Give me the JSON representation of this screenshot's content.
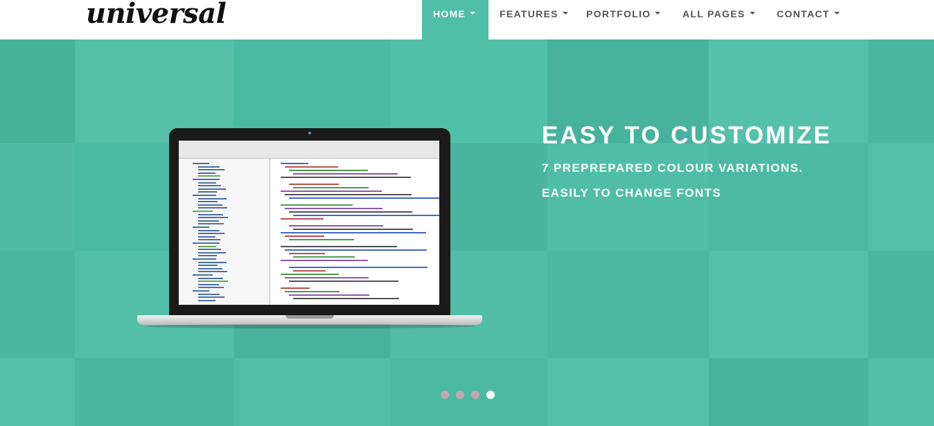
{
  "header": {
    "logo_text": "universal",
    "nav": [
      {
        "label": "HOME",
        "active": true
      },
      {
        "label": "FEATURES",
        "active": false
      },
      {
        "label": "PORTFOLIO",
        "active": false
      },
      {
        "label": "ALL PAGES",
        "active": false
      },
      {
        "label": "CONTACT",
        "active": false
      }
    ]
  },
  "hero": {
    "headline": "EASY TO CUSTOMIZE",
    "line1": "7 PREPREPARED COLOUR VARIATIONS.",
    "line2": "EASILY TO CHANGE FONTS",
    "slides": [
      {
        "active": false
      },
      {
        "active": false
      },
      {
        "active": false
      },
      {
        "active": true
      }
    ]
  },
  "colors": {
    "accent": "#4fbfa8",
    "header_bg": "#ffffff",
    "nav_text": "#555555",
    "dot_inactive": "#c4a6b2",
    "dot_active": "#ffffff"
  }
}
